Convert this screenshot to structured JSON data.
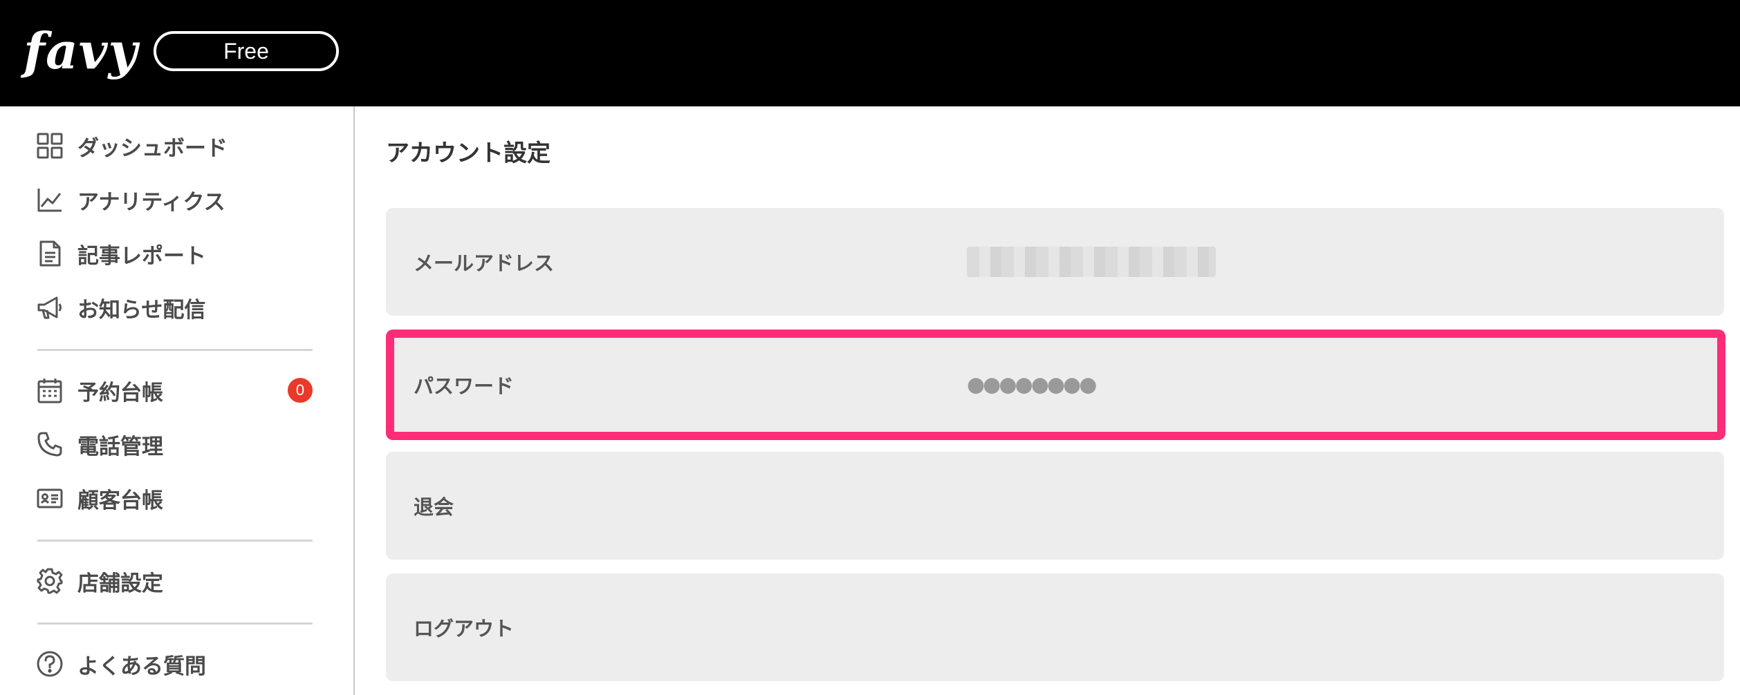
{
  "header": {
    "logo": "favy",
    "plan": "Free"
  },
  "sidebar": {
    "items": [
      {
        "label": "ダッシュボード",
        "icon": "dashboard-icon"
      },
      {
        "label": "アナリティクス",
        "icon": "analytics-icon"
      },
      {
        "label": "記事レポート",
        "icon": "document-icon"
      },
      {
        "label": "お知らせ配信",
        "icon": "megaphone-icon"
      },
      {
        "label": "予約台帳",
        "icon": "calendar-icon",
        "badge": "0"
      },
      {
        "label": "電話管理",
        "icon": "phone-icon"
      },
      {
        "label": "顧客台帳",
        "icon": "id-card-icon"
      },
      {
        "label": "店舗設定",
        "icon": "gear-icon"
      },
      {
        "label": "よくある質問",
        "icon": "help-icon"
      }
    ]
  },
  "main": {
    "title": "アカウント設定",
    "rows": [
      {
        "label": "メールアドレス",
        "value": ""
      },
      {
        "label": "パスワード",
        "value": "●●●●●●●●"
      },
      {
        "label": "退会",
        "value": ""
      },
      {
        "label": "ログアウト",
        "value": ""
      }
    ]
  },
  "colors": {
    "header_bg": "#000000",
    "highlight": "#ff2d78",
    "badge": "#e8392a",
    "row_bg": "#ededed"
  }
}
